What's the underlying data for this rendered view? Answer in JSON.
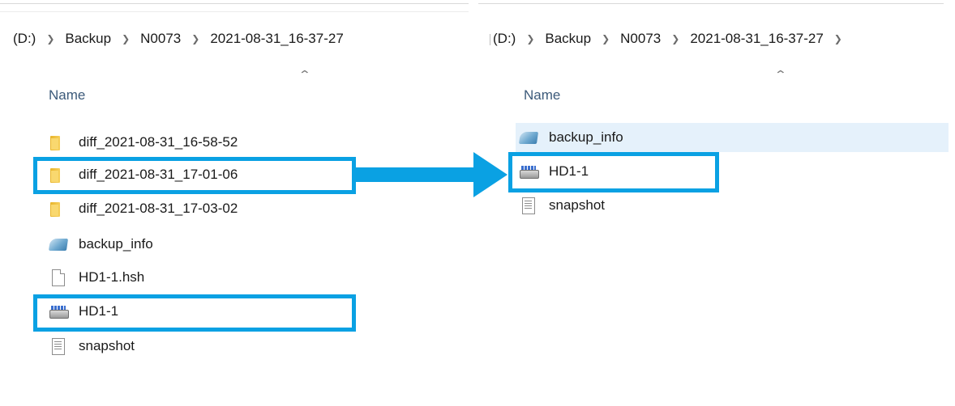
{
  "left_pane": {
    "breadcrumb": [
      "(D:)",
      "Backup",
      "N0073",
      "2021-08-31_16-37-27"
    ],
    "column_name": "Name",
    "files": [
      {
        "label": "diff_2021-08-31_16-58-52",
        "icon": "folder-icon"
      },
      {
        "label": "diff_2021-08-31_17-01-06",
        "icon": "folder-icon"
      },
      {
        "label": "diff_2021-08-31_17-03-02",
        "icon": "folder-icon"
      },
      {
        "label": "backup_info",
        "icon": "info-file-icon"
      },
      {
        "label": "HD1-1.hsh",
        "icon": "blank-file-icon"
      },
      {
        "label": "HD1-1",
        "icon": "drive-image-icon"
      },
      {
        "label": "snapshot",
        "icon": "text-file-icon"
      }
    ]
  },
  "right_pane": {
    "breadcrumb": [
      "(D:)",
      "Backup",
      "N0073",
      "2021-08-31_16-37-27"
    ],
    "column_name": "Name",
    "files": [
      {
        "label": "backup_info",
        "icon": "info-file-icon"
      },
      {
        "label": "HD1-1",
        "icon": "drive-image-icon"
      },
      {
        "label": "snapshot",
        "icon": "text-file-icon"
      }
    ]
  },
  "highlight_color": "#0aa1e3",
  "selected_row_color": "#e5f1fb"
}
